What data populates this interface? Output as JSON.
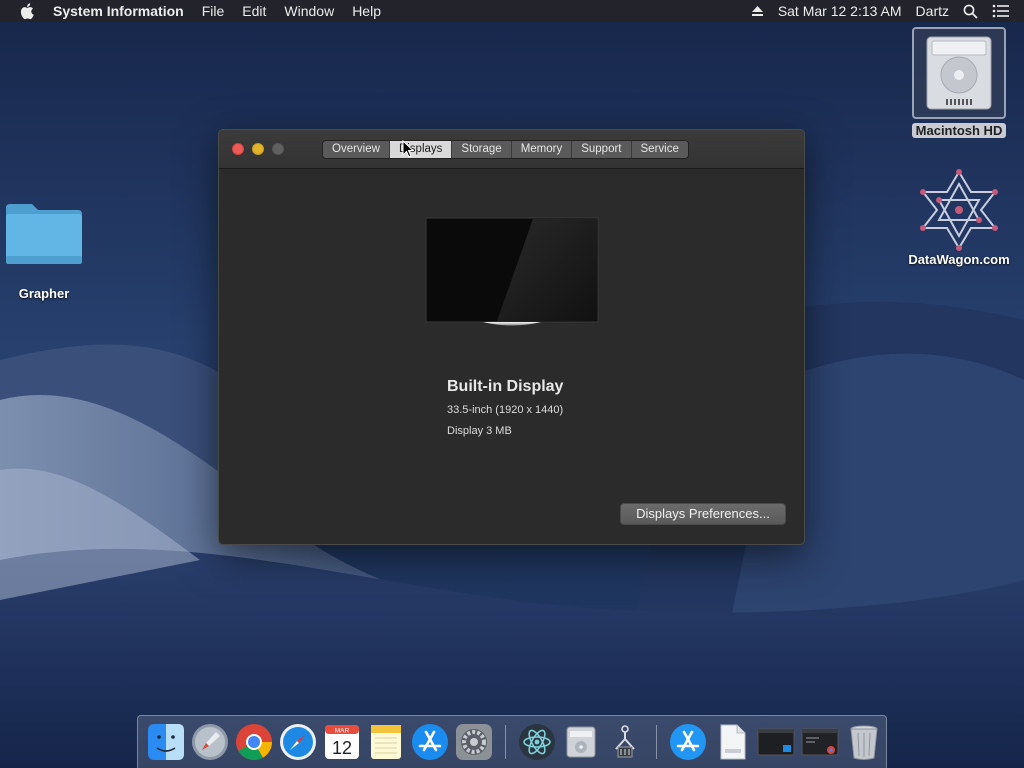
{
  "menubar": {
    "app_name": "System Information",
    "menus": [
      "File",
      "Edit",
      "Window",
      "Help"
    ],
    "clock": "Sat Mar 12  2:13 AM",
    "user": "Dartz"
  },
  "desktop": {
    "icons": [
      {
        "label": "Macintosh HD",
        "icon": "hard-drive-icon"
      },
      {
        "label": "DataWagon.com",
        "icon": "network-star-icon"
      },
      {
        "label": "Grapher",
        "icon": "folder-icon"
      }
    ]
  },
  "window": {
    "tabs": [
      "Overview",
      "Displays",
      "Storage",
      "Memory",
      "Support",
      "Service"
    ],
    "active_tab": "Displays",
    "display": {
      "name": "Built-in Display",
      "resolution": "33.5-inch (1920 x 1440)",
      "memory": "Display 3 MB"
    },
    "prefs_button": "Displays Preferences..."
  },
  "dock": {
    "items": [
      "finder-icon",
      "launchpad-icon",
      "chrome-icon",
      "safari-icon",
      "calendar-icon",
      "notes-icon",
      "app-store-icon",
      "system-preferences-icon",
      "atom-icon",
      "disk-utility-icon",
      "claw-machine-icon",
      "app-store-icon",
      "html-document-icon",
      "terminal-window-icon",
      "chrome-window-icon",
      "trash-icon"
    ],
    "calendar": {
      "month": "MAR",
      "day": "12"
    }
  },
  "colors": {
    "accent_close": "#ec5b55",
    "accent_min": "#e0b42a",
    "menubar": "#22232b",
    "window": "#2b2b2b"
  }
}
